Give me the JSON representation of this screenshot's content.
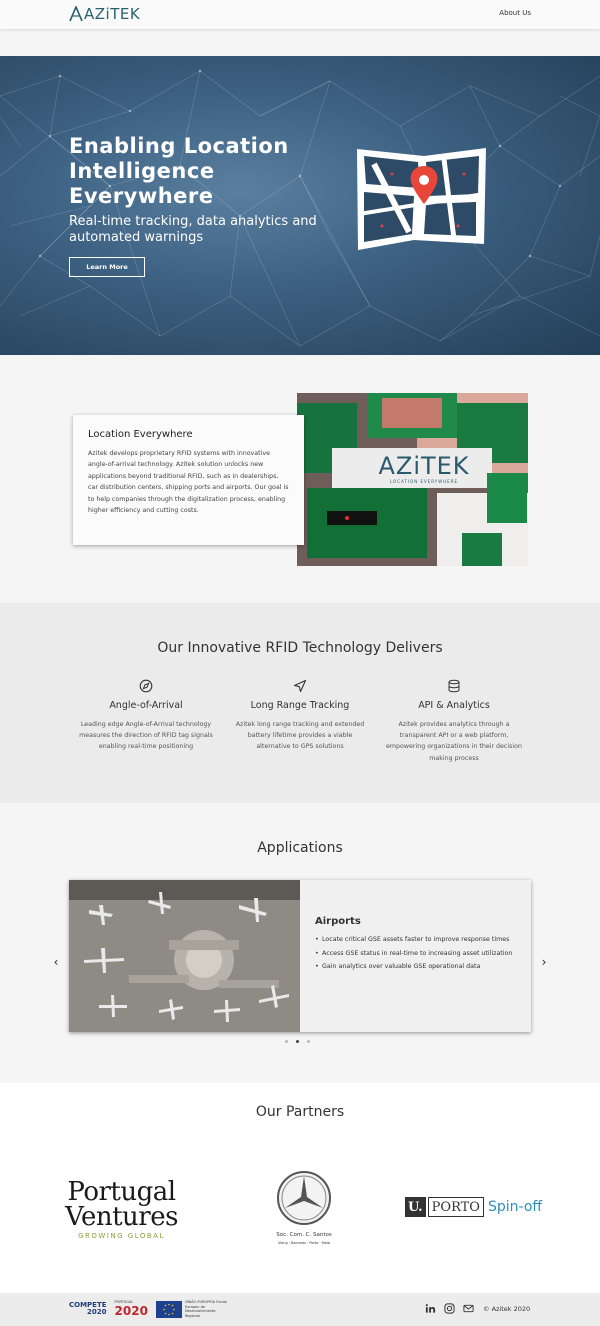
{
  "nav": {
    "brand": "AZiTEK",
    "about_label": "About Us"
  },
  "hero": {
    "title": "Enabling Location Intelligence Everywhere",
    "subtitle": "Real-time tracking, data analytics and automated warnings",
    "cta_label": "Learn More"
  },
  "about": {
    "title": "Location Everywhere",
    "body": "Azitek develops proprietary RFID systems with innovative angle-of-arrival technology. Azitek solution unlocks new applications beyond traditional RFID, such as in dealerships, car distribution centers, shipping ports and airports. Our goal is to help companies through the digitalization process, enabling higher efficiency and cutting costs.",
    "image_caption": "AZiTEK",
    "image_tagline": "LOCATION EVERYWHERE"
  },
  "tech": {
    "heading": "Our Innovative RFID Technology Delivers",
    "features": [
      {
        "icon": "compass-icon",
        "title": "Angle-of-Arrival",
        "text": "Leading edge Angle-of-Arrival technology measures the direction of RFID tag signals enabling real-time positioning"
      },
      {
        "icon": "navigation-icon",
        "title": "Long Range Tracking",
        "text": "Azitek long range tracking and extended battery lifetime provides a viable alternative to GPS solutions"
      },
      {
        "icon": "database-icon",
        "title": "API & Analytics",
        "text": "Azitek provides analytics through a transparent API or a web platform, empowering organizations in their decision making process"
      }
    ]
  },
  "applications": {
    "heading": "Applications",
    "slide": {
      "title": "Airports",
      "bullets": [
        "Locate critical GSE assets faster to improve response times",
        "Access GSE status in real-time to increasing asset utilization",
        "Gain analytics over valuable GSE operational data"
      ]
    },
    "prev": "‹",
    "next": "›"
  },
  "partners": {
    "heading": "Our Partners",
    "portugal_ventures": {
      "line1": "Portugal",
      "line2": "Ventures",
      "tagline": "GROWING GLOBAL"
    },
    "mercedes": {
      "name": "Soc. Com. C. Santos",
      "sub": "Viana · Barcelos · Porto · Maia"
    },
    "uporto": {
      "u": "U.",
      "porto": "PORTO",
      "spin": "Spin-off"
    }
  },
  "footer": {
    "compete_top": "COMPETE",
    "compete_year": "2020",
    "portugal_label": "PORTUGAL",
    "portugal_year": "2020",
    "eu_text": "UNIÃO EUROPEIA Fundo Europeu de Desenvolvimento Regional",
    "copyright": "© Azitek 2020"
  },
  "colors": {
    "brand": "#2a6171",
    "hero_bg": "#3e6283",
    "tech_bg": "#ebebeb",
    "spinoff": "#2a8fb8"
  }
}
